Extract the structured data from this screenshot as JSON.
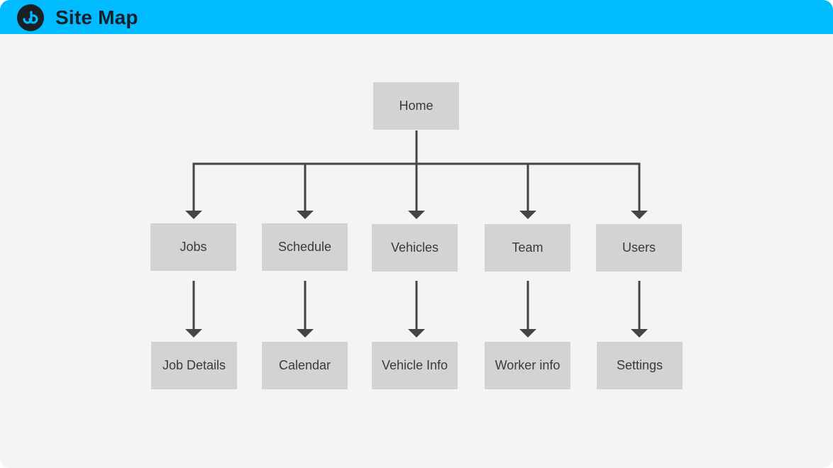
{
  "header": {
    "title": "Site Map",
    "logo_icon": "logo-icon",
    "background_color": "#00bbff"
  },
  "diagram": {
    "root": {
      "id": "home",
      "label": "Home"
    },
    "level1": [
      {
        "id": "jobs",
        "label": "Jobs",
        "child": {
          "id": "job-details",
          "label": "Job Details"
        }
      },
      {
        "id": "schedule",
        "label": "Schedule",
        "child": {
          "id": "calendar",
          "label": "Calendar"
        }
      },
      {
        "id": "vehicles",
        "label": "Vehicles",
        "child": {
          "id": "vehicle-info",
          "label": "Vehicle Info"
        }
      },
      {
        "id": "team",
        "label": "Team",
        "child": {
          "id": "worker-info",
          "label": "Worker info"
        }
      },
      {
        "id": "users",
        "label": "Users",
        "child": {
          "id": "settings",
          "label": "Settings"
        }
      }
    ],
    "colors": {
      "node_fill": "#d3d3d3",
      "node_text": "#3a3a3a",
      "connector": "#454545",
      "canvas": "#f4f4f4"
    }
  }
}
